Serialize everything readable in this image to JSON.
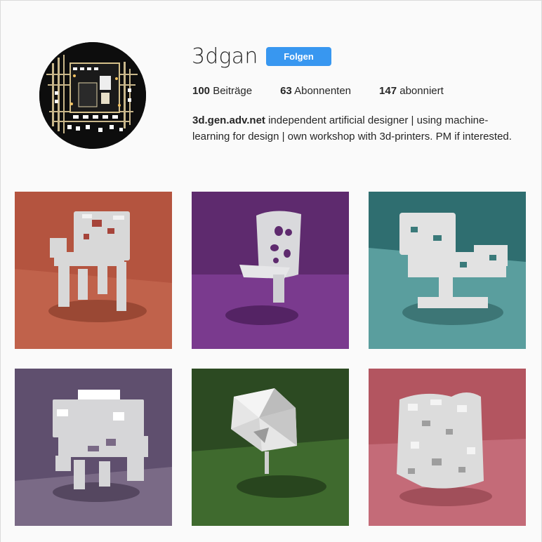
{
  "profile": {
    "username": "3dgan",
    "follow_label": "Folgen",
    "avatar_icon": "circuit-board-avatar-icon",
    "stats": [
      {
        "count": "100",
        "label": "Beiträge"
      },
      {
        "count": "63",
        "label": "Abonnenten"
      },
      {
        "count": "147",
        "label": "abonniert"
      }
    ],
    "bio_link": "3d.gen.adv.net",
    "bio_text": " independent artificial designer | using machine-learning for design | own workshop with 3d-printers. PM if interested."
  },
  "colors": {
    "accent": "#3897f0",
    "background": "#fafafa",
    "text": "#262626"
  },
  "posts": [
    {
      "bg": "#b4543f",
      "floor": "#c0624b",
      "object": "voxel-chair"
    },
    {
      "bg": "#5e2a6e",
      "floor": "#7a3a8e",
      "object": "smooth-chair"
    },
    {
      "bg": "#2f6e70",
      "floor": "#5a9e9e",
      "object": "voxel-armchair"
    },
    {
      "bg": "#5f4f6e",
      "floor": "#7a6a86",
      "object": "block-chair"
    },
    {
      "bg": "#2c4a22",
      "floor": "#3f6a2e",
      "object": "low-poly-object"
    },
    {
      "bg": "#b35560",
      "floor": "#c46b78",
      "object": "voxel-block"
    }
  ]
}
